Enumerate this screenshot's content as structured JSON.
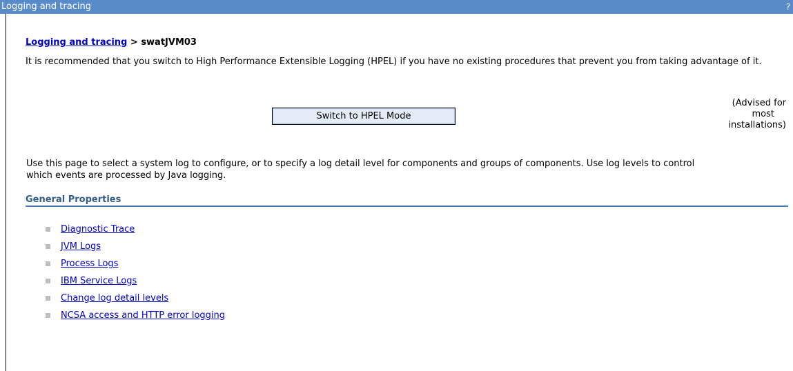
{
  "window": {
    "title": "Logging and tracing",
    "help_label": "?"
  },
  "breadcrumb": {
    "link": "Logging and tracing",
    "current": "swatJVM03"
  },
  "recommendation": "It is recommended that you switch to High Performance Extensible Logging (HPEL) if you have no existing procedures that prevent you from taking advantage of it.",
  "hpel": {
    "button_label": "Switch to HPEL Mode",
    "advice_line1": "(Advised for",
    "advice_line2": "most",
    "advice_line3": "installations)"
  },
  "description": "Use this page to select a system log to configure, or to specify a log detail level for components and groups of components. Use log levels to control which events are processed by Java logging.",
  "general_properties": {
    "title": "General Properties",
    "links": [
      "Diagnostic Trace",
      "JVM Logs",
      "Process Logs",
      "IBM Service Logs",
      "Change log detail levels",
      "NCSA access and HTTP error logging"
    ]
  }
}
